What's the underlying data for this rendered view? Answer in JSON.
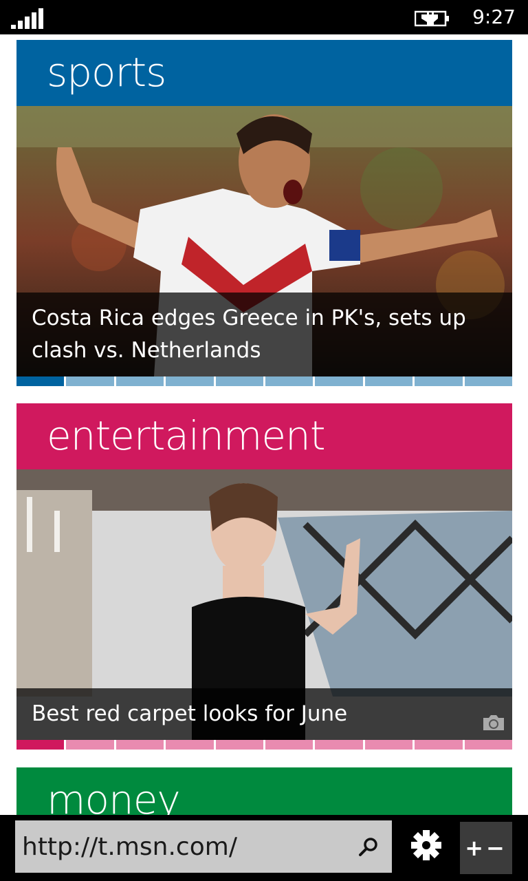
{
  "status": {
    "time": "9:27"
  },
  "tiles": [
    {
      "title": "sports",
      "color": "#0063a0",
      "caption": "Costa Rica edges Greece in PK's, sets up clash vs. Netherlands",
      "pager_active": "#0063a0",
      "pager_inactive": "#7fb1d0",
      "pages": 10,
      "active_page": 1
    },
    {
      "title": "entertainment",
      "color": "#d0195e",
      "caption": "Best red carpet looks for June",
      "pager_active": "#d0195e",
      "pager_inactive": "#e98bb0",
      "pages": 10,
      "active_page": 1,
      "media_icon": "camera-icon"
    },
    {
      "title": "money",
      "color": "#008a3e"
    }
  ],
  "appbar": {
    "address": "http://t.msn.com/",
    "search_icon": "search-icon",
    "settings_icon": "gear-icon",
    "tabs_label": "+−"
  }
}
